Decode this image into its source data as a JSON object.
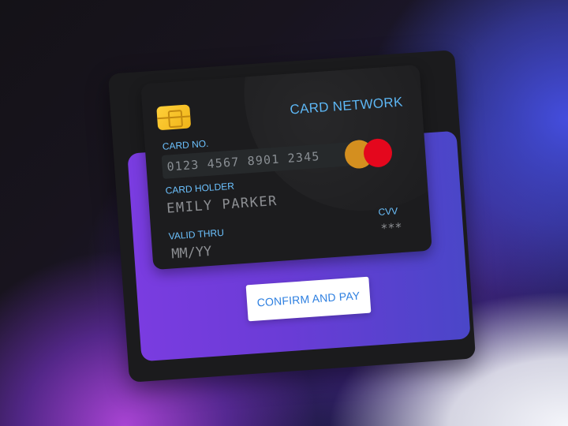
{
  "card": {
    "network": "CARD NETWORK",
    "number_label": "CARD NO.",
    "number_value": "0123 4567 8901 2345",
    "holder_label": "CARD HOLDER",
    "holder_value": "EMILY PARKER",
    "valid_label": "VALID THRU",
    "valid_value": "MM/YY",
    "cvv_label": "CVV",
    "cvv_value": "***",
    "logo_icon": "card-brand-circles-icon",
    "chip_icon": "chip-icon"
  },
  "actions": {
    "confirm_label": "CONFIRM AND PAY"
  },
  "colors": {
    "accent": "#5db7f5",
    "button_text": "#2d7fe0",
    "purple_panel": "#6a3cd6",
    "card_bg": "#1c1c1e",
    "chip": "#ffd03a",
    "logo_left": "#d48f1f",
    "logo_right": "#e4071d"
  }
}
